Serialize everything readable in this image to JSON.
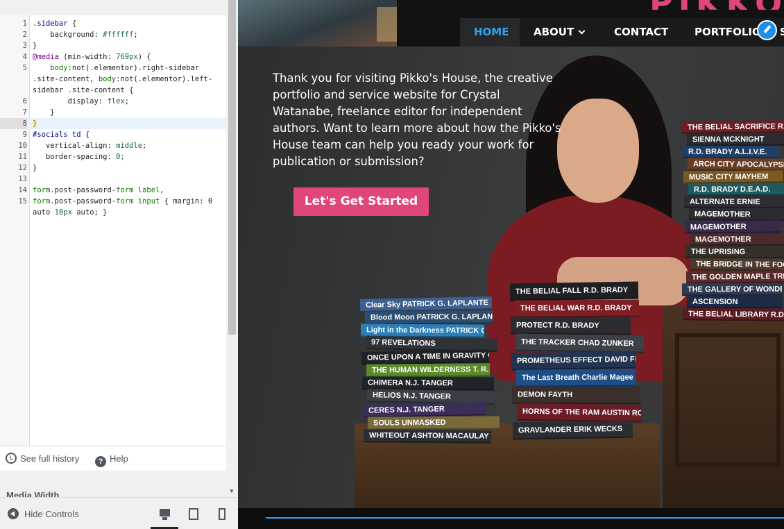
{
  "editor": {
    "lines": [
      {
        "n": "1",
        "t": ".sidebar {"
      },
      {
        "n": "2",
        "t": "    background: #ffffff;"
      },
      {
        "n": "3",
        "t": "}"
      },
      {
        "n": "4",
        "t": "@media (min-width: 769px) {"
      },
      {
        "n": "5",
        "t": "    body:not(.elementor).right-sidebar"
      },
      {
        "n": "",
        "t": ".site-content, body:not(.elementor).left-"
      },
      {
        "n": "",
        "t": "sidebar .site-content {"
      },
      {
        "n": "6",
        "t": "        display: flex;"
      },
      {
        "n": "7",
        "t": "    }"
      },
      {
        "n": "8",
        "t": "}"
      },
      {
        "n": "9",
        "t": "#socials td {"
      },
      {
        "n": "10",
        "t": "   vertical-align: middle;"
      },
      {
        "n": "11",
        "t": "   border-spacing: 0;"
      },
      {
        "n": "12",
        "t": "}"
      },
      {
        "n": "13",
        "t": ""
      },
      {
        "n": "14",
        "t": "form.post-password-form label,"
      },
      {
        "n": "15",
        "t": "form.post-password-form input { margin: 0"
      },
      {
        "n": "",
        "t": "auto 10px auto; }"
      }
    ],
    "active_line": "8"
  },
  "history": {
    "full_history_label": "See full history",
    "help_label": "Help"
  },
  "media_width_label": "Media Width",
  "footer": {
    "hide_controls_label": "Hide Controls"
  },
  "site": {
    "logo_text": "PIKKO'S",
    "nav": {
      "home": "HOME",
      "about": "ABOUT",
      "contact": "CONTACT",
      "portfolio": "PORTFOLIO",
      "cut_item": "S"
    },
    "hero_text": "Thank you for visiting Pikko's House, the creative portfolio and service website for Crystal Watanabe, freelance editor for independent authors. Want to learn more about how the Pikko's House team can help you ready your work for publication or submission?",
    "cta_label": "Let's Get Started",
    "books_left": [
      {
        "title": "Clear Sky    PATRICK G. LAPLANTE",
        "color": "#3e5f8f"
      },
      {
        "title": "Blood Moon    PATRICK G. LAPLANTE",
        "color": "#2c4d6e"
      },
      {
        "title": "Light in the Darkness  PATRICK G. LAPLANTE",
        "color": "#2a7fb8"
      },
      {
        "title": "97 REVELATIONS",
        "color": "#2f3338"
      },
      {
        "title": "ONCE UPON A TIME IN GRAVITY CITY",
        "color": "#1f2226"
      },
      {
        "title": "THE HUMAN WILDERNESS    T. R. LIVERIDIS",
        "color": "#5a8a2a"
      },
      {
        "title": "CHIMERA    N.J. TANGER",
        "color": "#202428"
      },
      {
        "title": "HELIOS     N.J. TANGER",
        "color": "#3a3e45"
      },
      {
        "title": "CERES      N.J. TANGER",
        "color": "#3b2f5a"
      },
      {
        "title": "SOULS UNMASKED",
        "color": "#7a6a3a"
      },
      {
        "title": "WHITEOUT      ASHTON MACAULAY",
        "color": "#2b2e32"
      }
    ],
    "books_mid": [
      {
        "title": "THE BELIAL FALL     R.D. BRADY",
        "color": "#1e1f22"
      },
      {
        "title": "THE BELIAL WAR      R.D. BRADY",
        "color": "#7c1f25"
      },
      {
        "title": "PROTECT      R.D. BRADY",
        "color": "#2a2c30"
      },
      {
        "title": "THE TRACKER     CHAD ZUNKER",
        "color": "#3d4046"
      },
      {
        "title": "PROMETHEUS EFFECT   DAVID FLEMING",
        "color": "#22344f"
      },
      {
        "title": "The Last Breath  Charlie Magee",
        "color": "#1d4e87"
      },
      {
        "title": "DEMON FAYTH",
        "color": "#3a2f2a"
      },
      {
        "title": "HORNS OF THE RAM   AUSTIN ROGERS",
        "color": "#6a1d24"
      },
      {
        "title": "GRAVLANDER     ERIK WECKS",
        "color": "#2a2d31"
      }
    ],
    "books_right": [
      {
        "title": "THE BELIAL SACRIFICE   R.D. BRADY",
        "color": "#6b1f25"
      },
      {
        "title": "SIENNA MCKNIGHT",
        "color": "#2a2c30"
      },
      {
        "title": "R.D. BRADY  A.L.I.V.E.",
        "color": "#1f3f66"
      },
      {
        "title": "ARCH CITY APOCALYPSE",
        "color": "#6a3e24"
      },
      {
        "title": "MUSIC CITY MAYHEM",
        "color": "#7a5a24"
      },
      {
        "title": "R.D. BRADY  D.E.A.D.",
        "color": "#1e5a5e"
      },
      {
        "title": "ALTERNATE   ERNIE",
        "color": "#2b2d31"
      },
      {
        "title": "MAGEMOTHER",
        "color": "#2a2c30"
      },
      {
        "title": "MAGEMOTHER",
        "color": "#3a2a4a"
      },
      {
        "title": "MAGEMOTHER",
        "color": "#4a2a2a"
      },
      {
        "title": "THE UPRISING",
        "color": "#33302c"
      },
      {
        "title": "THE BRIDGE IN THE FOG",
        "color": "#4b3a2a"
      },
      {
        "title": "THE GOLDEN MAPLE TREE",
        "color": "#5a2a2a"
      },
      {
        "title": "THE GALLERY OF WONDERS",
        "color": "#2f3a52"
      },
      {
        "title": "ASCENSION",
        "color": "#1d2a44"
      },
      {
        "title": "THE BELIAL LIBRARY   R.D. BRADY",
        "color": "#5a1c22"
      }
    ]
  },
  "colors": {
    "accent_pink": "#e0457b",
    "nav_active_blue": "#2ea3f2"
  }
}
